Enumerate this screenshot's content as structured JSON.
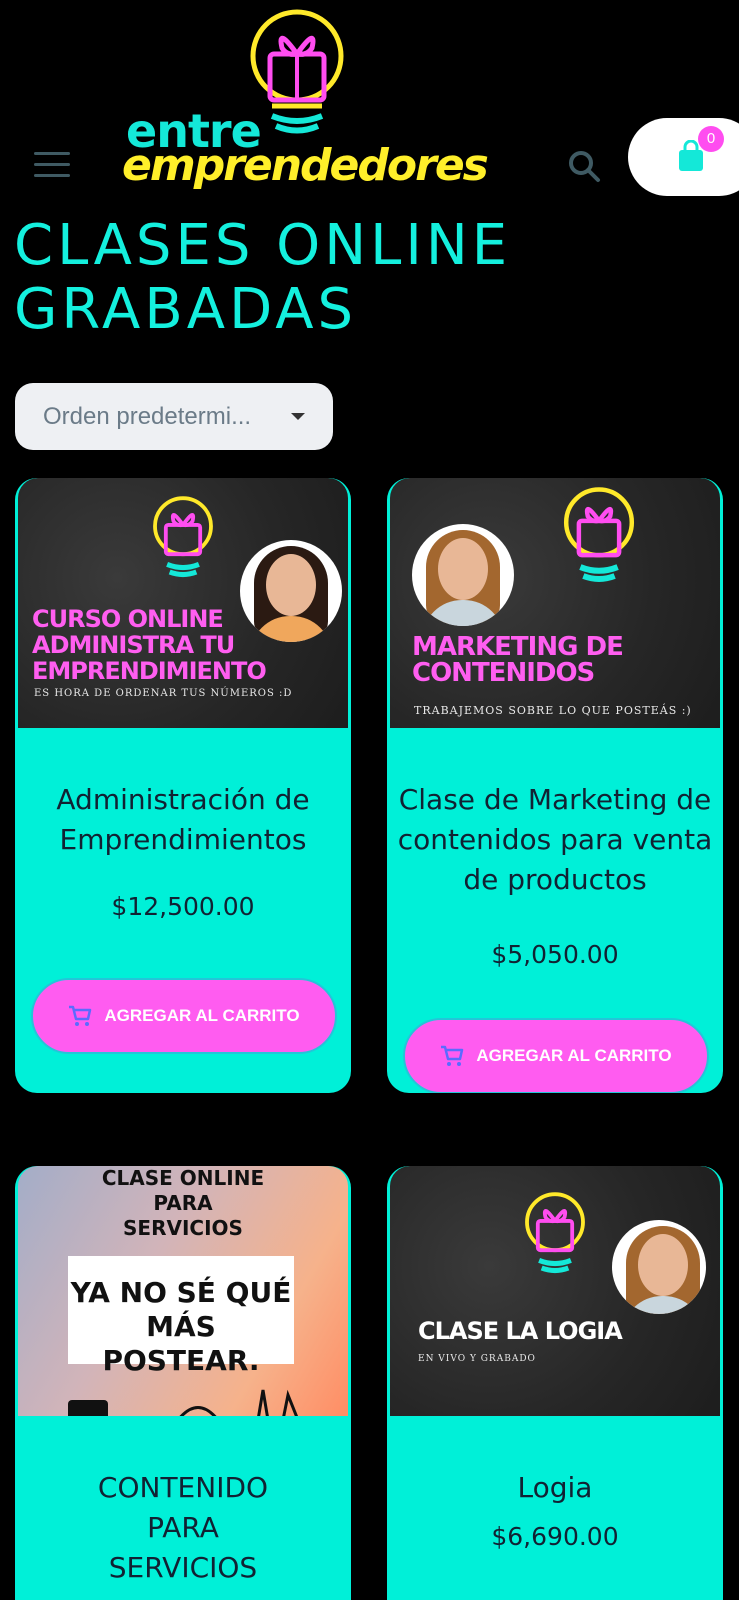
{
  "header": {
    "logo_line1": "entre",
    "logo_line2": "emprendedores",
    "cart_count": "0"
  },
  "page_title": "CLASES ONLINE GRABADAS",
  "sort": {
    "selected": "Orden predetermi..."
  },
  "products": [
    {
      "name": "Administración de Emprendimientos",
      "price": "$12,500.00",
      "cta": "AGREGAR AL CARRITO",
      "thumb_heading": "CURSO ONLINE ADMINISTRA TU EMPRENDIMIENTO",
      "thumb_tag": "ES HORA DE ORDENAR TUS NÚMEROS :D"
    },
    {
      "name": "Clase de Marketing de contenidos para venta de productos",
      "price": "$5,050.00",
      "cta": "AGREGAR AL CARRITO",
      "thumb_heading": "MARKETING DE CONTENIDOS",
      "thumb_tag": "TRABAJEMOS SOBRE LO QUE POSTEÁS :)"
    },
    {
      "name": "CONTENIDO PARA SERVICIOS",
      "thumb_top": "CLASE ONLINE PARA SERVICIOS",
      "thumb_box": "YA NO SÉ QUÉ MÁS POSTEAR."
    },
    {
      "name": "Logia",
      "price": "$6,690.00",
      "thumb_heading": "CLASE LA LOGIA",
      "thumb_tag": "EN VIVO Y GRABADO"
    }
  ],
  "colors": {
    "accent_cyan": "#00f0d8",
    "accent_pink": "#ff5cf0",
    "logo_yellow": "#ffef2a"
  },
  "icons": [
    "menu-icon",
    "search-icon",
    "shopping-bag-icon",
    "cart-icon",
    "lightbulb-logo-icon"
  ]
}
